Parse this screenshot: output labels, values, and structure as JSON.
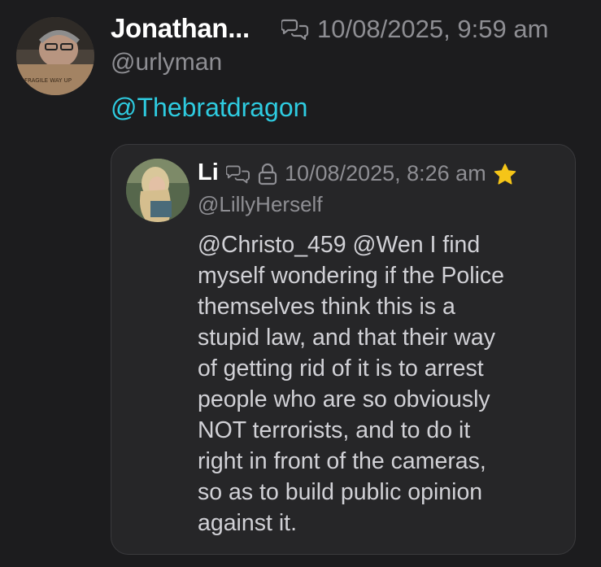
{
  "post": {
    "author_name": "Jonathan...",
    "author_handle": "@urlyman",
    "timestamp": "10/08/2025, 9:59 am",
    "reply_icon": "quote-bubbles-icon",
    "body_mention": "@Thebratdragon",
    "avatar_icon": "user-avatar",
    "avatar_box_text": "FRAGILE WAY UP"
  },
  "quoted_post": {
    "author_name": "Li",
    "author_handle": "@LillyHerself",
    "timestamp": "10/08/2025, 8:26 am",
    "reply_icon": "quote-bubbles-icon",
    "lock_icon": "lock-icon",
    "star_icon": "star-icon",
    "avatar_icon": "user-avatar",
    "body_lines": [
      "@Christo_459 @Wen I find",
      "myself wondering if the Police",
      "themselves think this is a",
      "stupid law, and that their way",
      "of getting rid of it is to arrest",
      "people who are so obviously",
      "NOT terrorists, and to do it",
      "right in front of the cameras,",
      "so as to build public opinion",
      "against it."
    ]
  },
  "colors": {
    "background": "#1c1c1e",
    "card": "#262628",
    "mention": "#2ecbe0",
    "muted": "#8e8e93",
    "star": "#f5c518"
  }
}
